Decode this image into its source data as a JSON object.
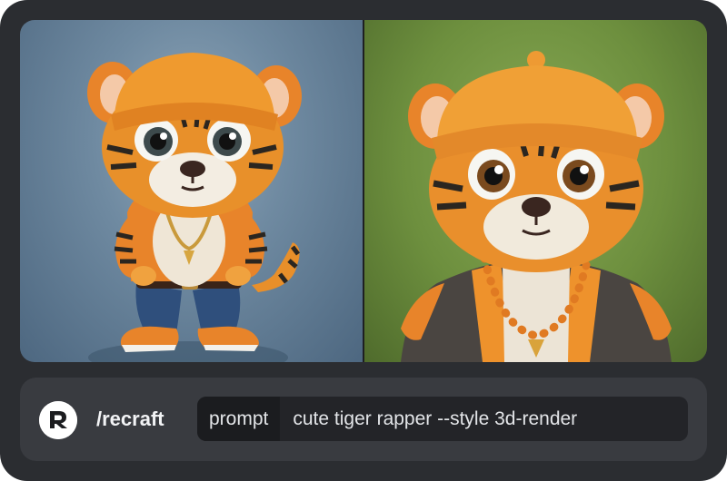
{
  "images": [
    {
      "alt": "3D render of a cute cartoon tiger in an orange beanie and gold chain, standing full body on a blue-grey backdrop"
    },
    {
      "alt": "3D render of a cute cartoon tiger in an orange beanie, orange bead necklace and open jacket on a green backdrop"
    }
  ],
  "command_bar": {
    "logo_icon": "recraft-logo-icon",
    "command": "/recraft",
    "argument_name": "prompt",
    "argument_value": "cute tiger rapper --style 3d-render"
  },
  "colors": {
    "frame": "#2b2d31",
    "bar": "#393b40",
    "arg_box": "#232428"
  }
}
